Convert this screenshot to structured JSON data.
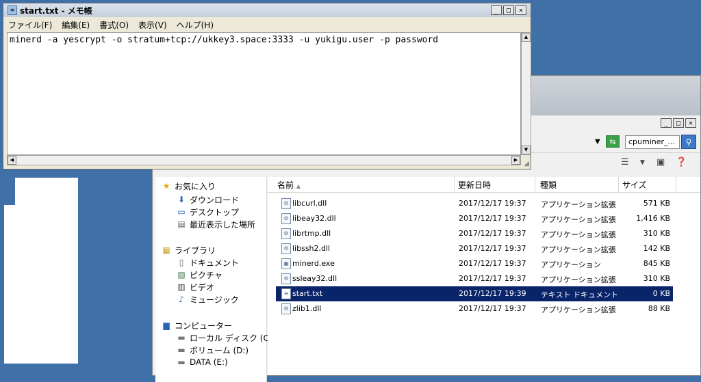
{
  "notepad": {
    "title": "start.txt - メモ帳",
    "menu": [
      "ファイル(F)",
      "編集(E)",
      "書式(O)",
      "表示(V)",
      "ヘルプ(H)"
    ],
    "content": "minerd -a yescrypt -o stratum+tcp://ukkey3.space:3333 -u yukigu.user -p password"
  },
  "explorer": {
    "search_text": "cpuminer_...",
    "nav": {
      "favorites": "お気に入り",
      "downloads": "ダウンロード",
      "desktop": "デスクトップ",
      "recent": "最近表示した場所",
      "libraries": "ライブラリ",
      "documents": "ドキュメント",
      "pictures": "ピクチャ",
      "videos": "ビデオ",
      "music": "ミュージック",
      "computer": "コンピューター",
      "local_disk": "ローカル ディスク (C:)",
      "volume_d": "ボリューム (D:)",
      "data_e": "DATA (E:)"
    },
    "columns": {
      "name": "名前",
      "date": "更新日時",
      "type": "種類",
      "size": "サイズ"
    },
    "files": [
      {
        "name": "libcurl.dll",
        "date": "2017/12/17 19:37",
        "type": "アプリケーション拡張",
        "size": "571 KB"
      },
      {
        "name": "libeay32.dll",
        "date": "2017/12/17 19:37",
        "type": "アプリケーション拡張",
        "size": "1,416 KB"
      },
      {
        "name": "librtmp.dll",
        "date": "2017/12/17 19:37",
        "type": "アプリケーション拡張",
        "size": "310 KB"
      },
      {
        "name": "libssh2.dll",
        "date": "2017/12/17 19:37",
        "type": "アプリケーション拡張",
        "size": "142 KB"
      },
      {
        "name": "minerd.exe",
        "date": "2017/12/17 19:37",
        "type": "アプリケーション",
        "size": "845 KB"
      },
      {
        "name": "ssleay32.dll",
        "date": "2017/12/17 19:37",
        "type": "アプリケーション拡張",
        "size": "310 KB"
      },
      {
        "name": "start.txt",
        "date": "2017/12/17 19:39",
        "type": "テキスト ドキュメント",
        "size": "0 KB"
      },
      {
        "name": "zlib1.dll",
        "date": "2017/12/17 19:37",
        "type": "アプリケーション拡張",
        "size": "88 KB"
      }
    ]
  }
}
